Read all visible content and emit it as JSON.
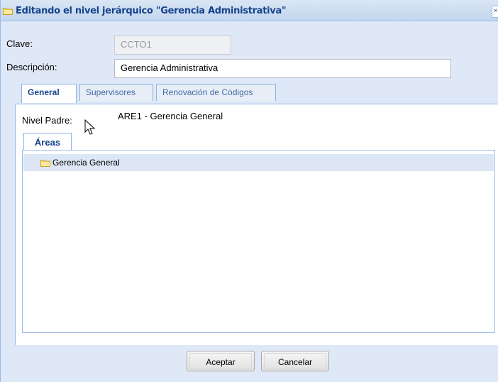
{
  "window": {
    "title": "Editando el nivel jerárquico \"Gerencia Administrativa\"",
    "close_glyph": "×"
  },
  "form": {
    "clave_label": "Clave:",
    "clave_value": "CCTO1",
    "descripcion_label": "Descripción:",
    "descripcion_value": "Gerencia Administrativa"
  },
  "tabs": [
    {
      "label": "General",
      "active": true
    },
    {
      "label": "Supervisores",
      "active": false
    },
    {
      "label": "Renovación de Códigos",
      "active": false
    }
  ],
  "general": {
    "nivel_padre_label": "Nivel Padre:",
    "nivel_padre_value": "ARE1 - Gerencia General",
    "subtab_label": "Áreas",
    "tree_items": [
      {
        "label": "Gerencia General",
        "icon": "folder-icon",
        "selected": true
      }
    ]
  },
  "buttons": {
    "accept": "Aceptar",
    "cancel": "Cancelar"
  },
  "colors": {
    "title_text": "#15428b",
    "window_bg": "#dfe8f6",
    "border": "#99bbe8",
    "selected_row": "#dce6f4"
  }
}
